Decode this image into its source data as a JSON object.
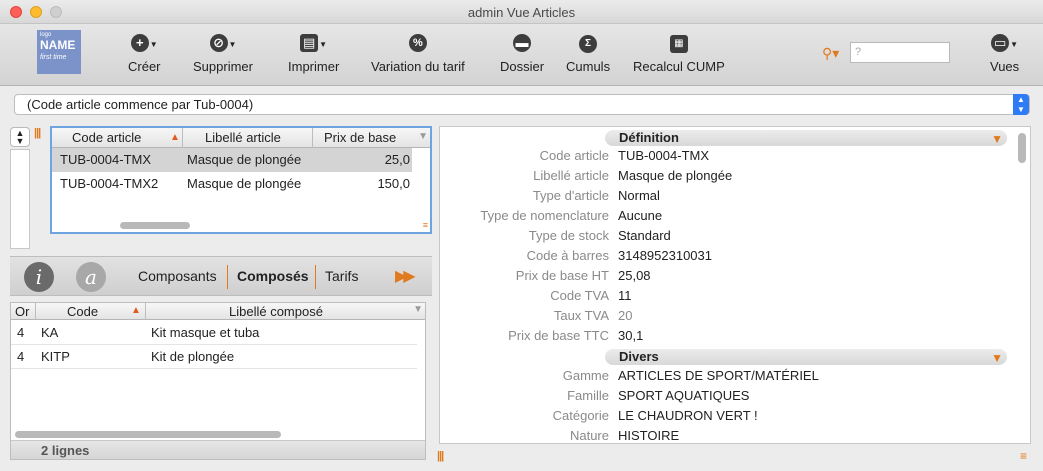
{
  "window": {
    "title": "admin Vue Articles"
  },
  "logo": {
    "line1": "logo",
    "line2": "NAME",
    "line3": "first time"
  },
  "toolbar": {
    "create": "Créer",
    "delete": "Supprimer",
    "print": "Imprimer",
    "tariff_variation": "Variation du tarif",
    "folder": "Dossier",
    "totals": "Cumuls",
    "recalc": "Recalcul CUMP",
    "views": "Vues",
    "search_placeholder": "?"
  },
  "filter": {
    "text": "(Code article commence par Tub-0004)"
  },
  "articles": {
    "headers": {
      "code": "Code article",
      "label": "Libellé article",
      "price": "Prix de base"
    },
    "rows": [
      {
        "code": "TUB-0004-TMX",
        "label": "Masque de plongée",
        "price": "25,0"
      },
      {
        "code": "TUB-0004-TMX2",
        "label": "Masque de plongée",
        "price": "150,0"
      }
    ]
  },
  "tabs": {
    "info_icon": "i",
    "at_icon": "a",
    "components": "Composants",
    "composed": "Composés",
    "tariffs": "Tarifs"
  },
  "composed": {
    "headers": {
      "order": "Or",
      "code": "Code",
      "label": "Libellé composé"
    },
    "rows": [
      {
        "order": "4",
        "code": "KA",
        "label": "Kit masque et tuba"
      },
      {
        "order": "4",
        "code": "KITP",
        "label": "Kit de plongée"
      }
    ],
    "footer": "2 lignes"
  },
  "detail": {
    "section_definition": "Définition",
    "section_misc": "Divers",
    "definition": [
      {
        "label": "Code article",
        "value": "TUB-0004-TMX"
      },
      {
        "label": "Libellé article",
        "value": "Masque de plongée"
      },
      {
        "label": "Type d'article",
        "value": "Normal"
      },
      {
        "label": "Type de nomenclature",
        "value": "Aucune"
      },
      {
        "label": "Type de stock",
        "value": "Standard"
      },
      {
        "label": "Code à barres",
        "value": "3148952310031"
      },
      {
        "label": "Prix de base HT",
        "value": "25,08"
      },
      {
        "label": "Code TVA",
        "value": "11"
      },
      {
        "label": "Taux TVA",
        "value": "20"
      },
      {
        "label": "Prix de base TTC",
        "value": "30,1"
      }
    ],
    "misc": [
      {
        "label": "Gamme",
        "value": "ARTICLES DE SPORT/MATÉRIEL"
      },
      {
        "label": "Famille",
        "value": "SPORT AQUATIQUES"
      },
      {
        "label": "Catégorie",
        "value": "LE CHAUDRON VERT !"
      },
      {
        "label": "Nature",
        "value": "HISTOIRE"
      }
    ]
  }
}
